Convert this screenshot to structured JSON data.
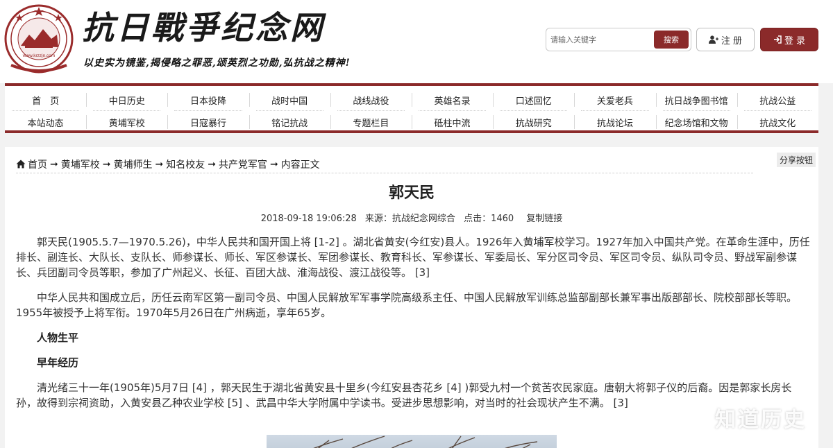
{
  "header": {
    "site_title": "抗日戰爭纪念网",
    "slogan": "以史实为镜鉴,揭侵略之罪恶,颂英烈之功勋,弘抗战之精神!",
    "logo_url_text": "www.krzzjn.com",
    "logo_seal_text": "抗日战争纪念网",
    "search": {
      "placeholder": "请输入关键字",
      "button_label": "搜索"
    },
    "register_label": "注 册",
    "login_label": "登 录",
    "colors": {
      "brand": "#8b2a2a"
    }
  },
  "nav": {
    "row1": [
      "首　页",
      "中日历史",
      "日本投降",
      "战时中国",
      "战线战役",
      "英雄名录",
      "口述回忆",
      "关爱老兵",
      "抗日战争图书馆",
      "抗战公益"
    ],
    "row2": [
      "本站动态",
      "黄埔军校",
      "日寇暴行",
      "铭记抗战",
      "专题栏目",
      "砥柱中流",
      "抗战研究",
      "抗战论坛",
      "纪念场馆和文物",
      "抗战文化"
    ]
  },
  "breadcrumb": [
    "首页",
    "黄埔军校",
    "黄埔师生",
    "知名校友",
    "共产党军官",
    "内容正文"
  ],
  "share_label": "分享按钮",
  "article": {
    "title": "郭天民",
    "date": "2018-09-18 19:06:28",
    "source": "来源：抗战纪念网综合",
    "clicks": "点击：1460",
    "copy_link": "复制链接",
    "para1": "郭天民(1905.5.7—1970.5.26)，中华人民共和国开国上将 [1-2] 。湖北省黄安(今红安)县人。1926年入黄埔军校学习。1927年加入中国共产党。在革命生涯中，历任排长、副连长、大队长、支队长、师参谋长、师长、军区参谋长、军团参谋长、教育科长、军参谋长、军委局长、军分区司令员、军区司令员、纵队司令员、野战军副参谋长、兵团副司令员等职，参加了广州起义、长征、百团大战、淮海战役、渡江战役等。 [3]",
    "para2": "中华人民共和国成立后，历任云南军区第一副司令员、中国人民解放军军事学院高级系主任、中国人民解放军训练总监部副部长兼军事出版部部长、院校部部长等职。1955年被授予上将军衔。1970年5月26日在广州病逝，享年65岁。",
    "heading1": "人物生平",
    "heading2": "早年经历",
    "para3": "清光绪三十一年(1905年)5月7日 [4] ，郭天民生于湖北省黄安县十里乡(今红安县杏花乡 [4] )郭受九村一个贫苦农民家庭。唐朝大将郭子仪的后裔。因是郭家长房长孙，故得到宗祠资助，入黄安县乙种农业学校 [5] 、武昌中华大学附属中学读书。受进步思想影响，对当时的社会现状产生不满。 [3]"
  },
  "watermark": "知道历史"
}
